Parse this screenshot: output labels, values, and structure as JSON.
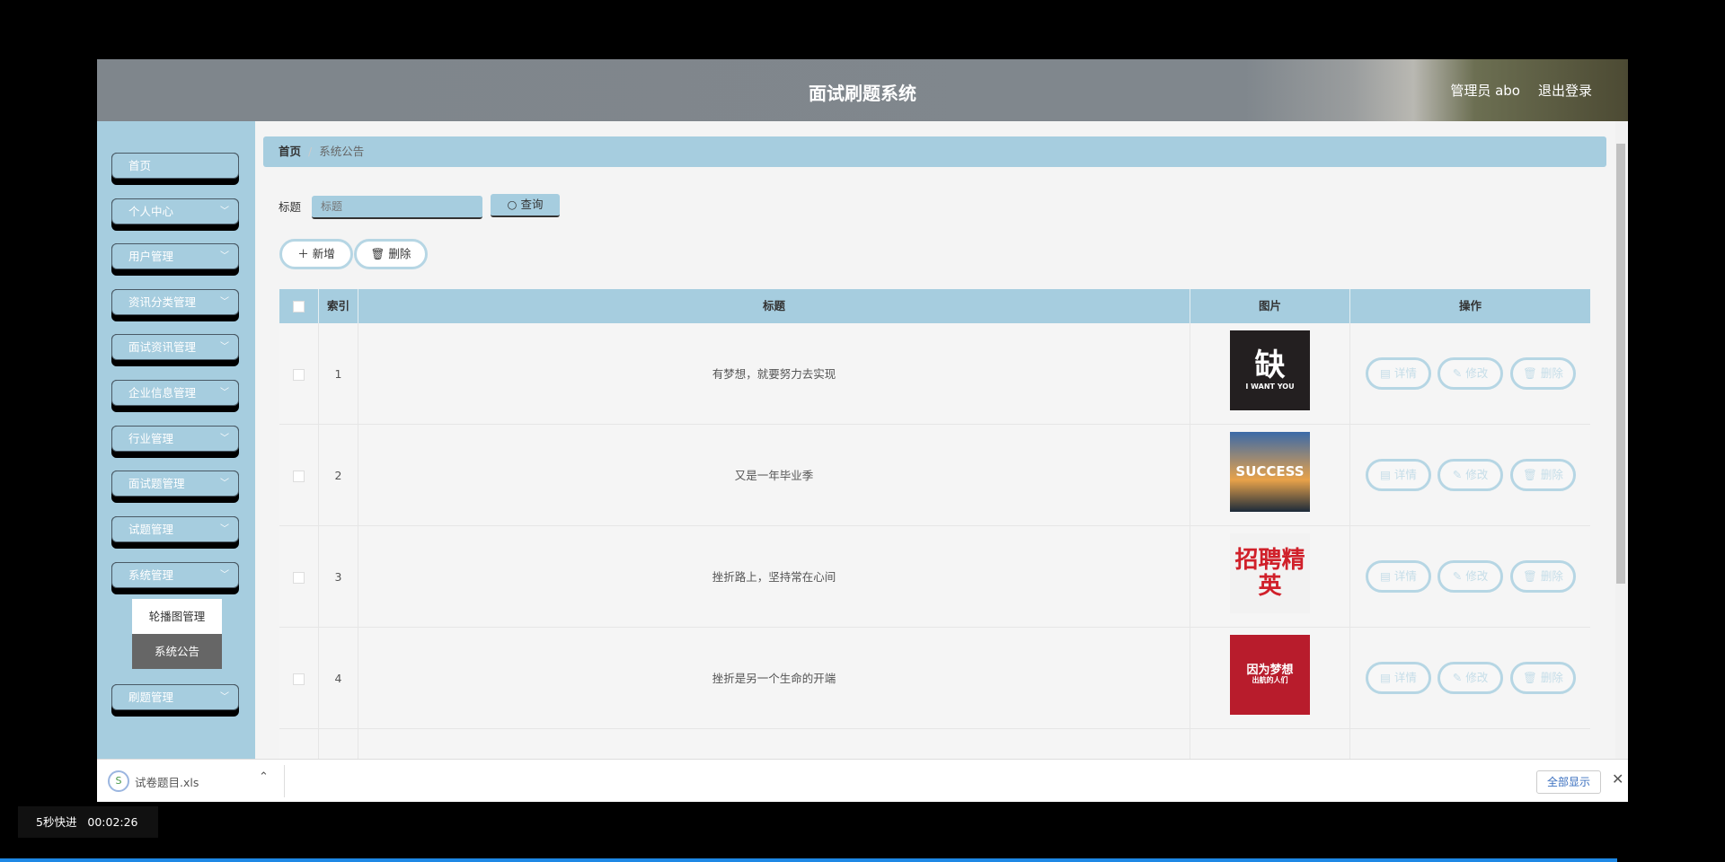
{
  "header": {
    "title": "面试刷题系统",
    "user": "管理员 abo",
    "logout": "退出登录"
  },
  "sidebar": {
    "items": [
      {
        "label": "首页",
        "chevron": false
      },
      {
        "label": "个人中心",
        "chevron": true
      },
      {
        "label": "用户管理",
        "chevron": true
      },
      {
        "label": "资讯分类管理",
        "chevron": true
      },
      {
        "label": "面试资讯管理",
        "chevron": true
      },
      {
        "label": "企业信息管理",
        "chevron": true
      },
      {
        "label": "行业管理",
        "chevron": true
      },
      {
        "label": "面试题管理",
        "chevron": true
      },
      {
        "label": "试题管理",
        "chevron": true
      },
      {
        "label": "系统管理",
        "chevron": true
      },
      {
        "label": "刷题管理",
        "chevron": true
      }
    ],
    "submenu": [
      {
        "label": "轮播图管理",
        "active": false
      },
      {
        "label": "系统公告",
        "active": true
      }
    ]
  },
  "breadcrumb": {
    "home": "首页",
    "current": "系统公告"
  },
  "search": {
    "label": "标题",
    "placeholder": "标题",
    "query_label": "查询"
  },
  "actions": {
    "add": "新增",
    "delete": "删除"
  },
  "table": {
    "headers": {
      "index": "索引",
      "title": "标题",
      "image": "图片",
      "ops": "操作"
    },
    "rows": [
      {
        "index": "1",
        "title": "有梦想，就要努力去实现",
        "image_text": "缺",
        "image_sub": "I WANT YOU"
      },
      {
        "index": "2",
        "title": "又是一年毕业季",
        "image_text": "SUCCESS",
        "image_sub": ""
      },
      {
        "index": "3",
        "title": "挫折路上，坚持常在心间",
        "image_text": "招聘精英",
        "image_sub": ""
      },
      {
        "index": "4",
        "title": "挫折是另一个生命的开端",
        "image_text": "因为梦想",
        "image_sub": "出航的人们"
      }
    ],
    "ops": {
      "detail": "详情",
      "edit": "修改",
      "delete": "删除"
    }
  },
  "download_bar": {
    "file": "试卷题目.xls",
    "show_all": "全部显示"
  },
  "overlay": {
    "skip": "5秒快进",
    "time": "00:02:26"
  },
  "colors": {
    "accent": "#a6cddf",
    "header": "#7f868c"
  }
}
